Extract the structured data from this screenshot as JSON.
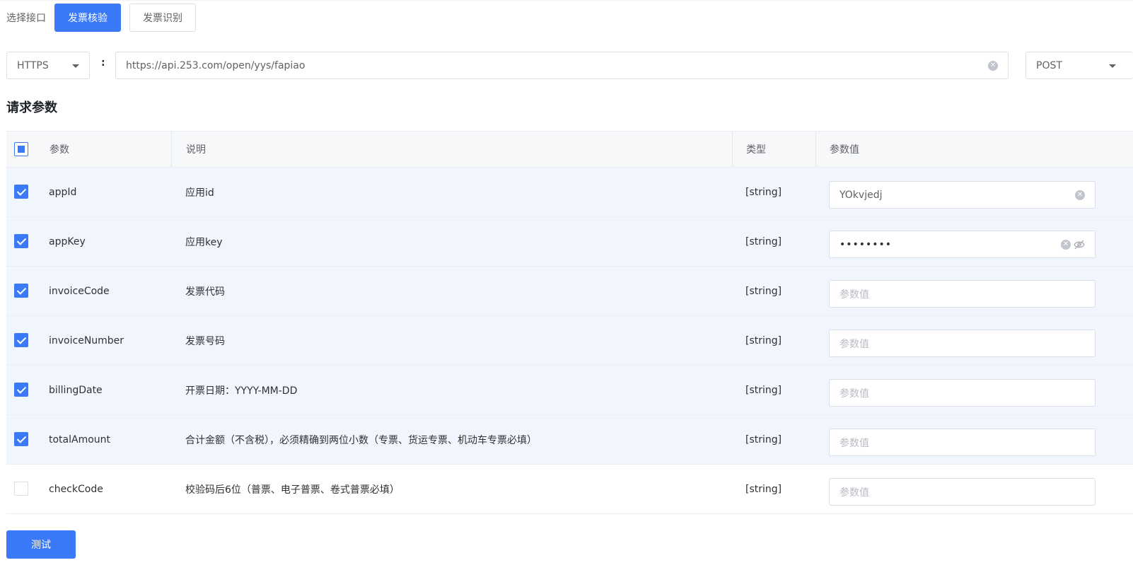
{
  "interface": {
    "label": "选择接口",
    "options": [
      "发票核验",
      "发票识别"
    ],
    "active": "发票核验"
  },
  "request": {
    "protocol": "HTTPS",
    "colon": ":",
    "url": "https://api.253.com/open/yys/fapiao",
    "method": "POST"
  },
  "params_section": {
    "title": "请求参数",
    "columns": {
      "param": "参数",
      "desc": "说明",
      "type": "类型",
      "value": "参数值"
    },
    "header_checkbox_state": "indeterminate",
    "rows": [
      {
        "name": "appId",
        "desc": "应用id",
        "type": "[string]",
        "checked": true,
        "value": "YOkvjedj",
        "placeholder": "参数值",
        "masked": false
      },
      {
        "name": "appKey",
        "desc": "应用key",
        "type": "[string]",
        "checked": true,
        "value": "••••••••",
        "placeholder": "参数值",
        "masked": true
      },
      {
        "name": "invoiceCode",
        "desc": "发票代码",
        "type": "[string]",
        "checked": true,
        "value": "",
        "placeholder": "参数值",
        "masked": false
      },
      {
        "name": "invoiceNumber",
        "desc": "发票号码",
        "type": "[string]",
        "checked": true,
        "value": "",
        "placeholder": "参数值",
        "masked": false
      },
      {
        "name": "billingDate",
        "desc": "开票日期：YYYY-MM-DD",
        "type": "[string]",
        "checked": true,
        "value": "",
        "placeholder": "参数值",
        "masked": false
      },
      {
        "name": "totalAmount",
        "desc": "合计金额（不含税），必须精确到两位小数（专票、货运专票、机动车专票必填）",
        "type": "[string]",
        "checked": true,
        "value": "",
        "placeholder": "参数值",
        "masked": false
      },
      {
        "name": "checkCode",
        "desc": "校验码后6位（普票、电子普票、卷式普票必填）",
        "type": "[string]",
        "checked": false,
        "value": "",
        "placeholder": "参数值",
        "masked": false
      }
    ]
  },
  "actions": {
    "test_label": "测试"
  },
  "colors": {
    "primary": "#3a7af8",
    "row_selected": "#f1f5fe",
    "header_bg": "#f7f8fa"
  }
}
